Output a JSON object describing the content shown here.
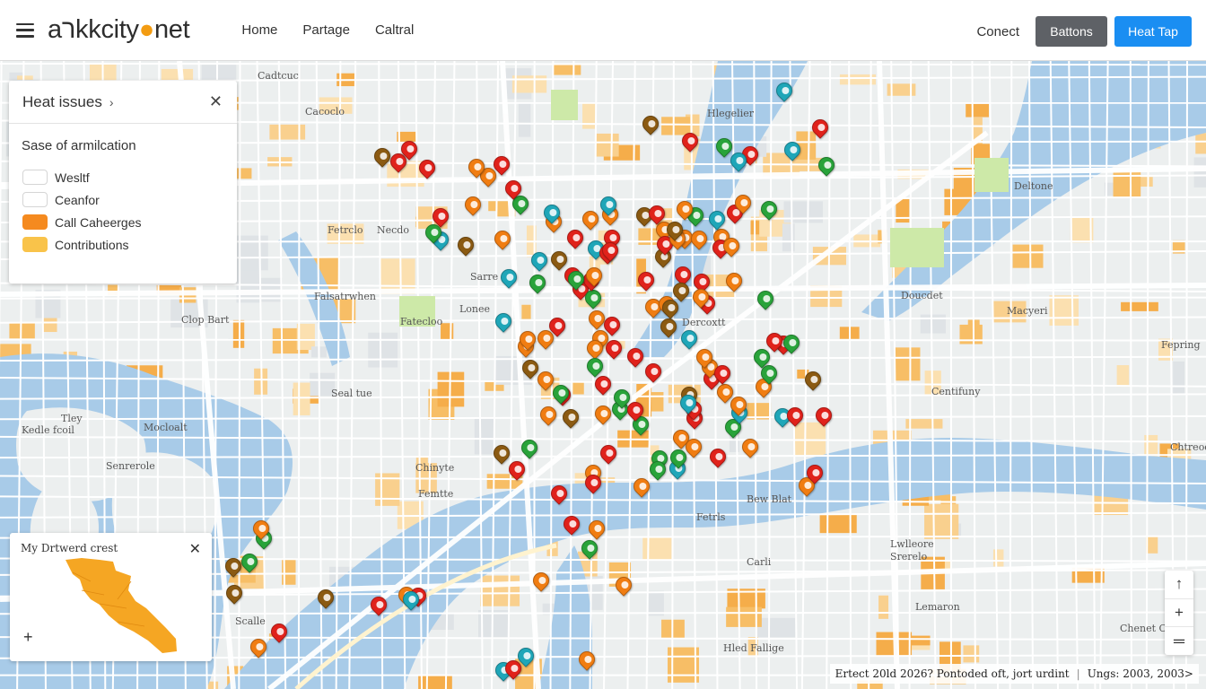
{
  "header": {
    "logo_text": "aרkkcity",
    "logo_suffix": "net",
    "nav": [
      "Home",
      "Partage",
      "Caltral"
    ],
    "connect_label": "Conect",
    "buttons_label": "Battons",
    "heat_tap_label": "Heat Tap"
  },
  "legend_panel": {
    "title": "Heat issues",
    "subtitle": "Sase of armilcation",
    "items": [
      {
        "label": "Wesltf",
        "color": "#ffffff"
      },
      {
        "label": "Ceanfor",
        "color": "#ffffff"
      },
      {
        "label": "Call Caheerges",
        "color": "#f58a1f"
      },
      {
        "label": "Contributions",
        "color": "#f9c34a"
      }
    ]
  },
  "mini_card": {
    "title": "My Drtwerd crest",
    "fill_color": "#f5a623"
  },
  "map_labels": [
    "Cadtcuc",
    "Cacoclo",
    "Fetrclo",
    "Necdo",
    "Falsatrwhen",
    "Clop Bart",
    "Sarre",
    "Lonee",
    "Fatecloo",
    "Seal tue",
    "Tley",
    "Kedle fcoil",
    "Mocloalt",
    "Senrerole",
    "Chinyte",
    "Femtte",
    "Deltone",
    "Macyeri",
    "Fepring",
    "Centifuny",
    "Chtreod Cyle",
    "Dercoxtt",
    "Bew Blat",
    "Fetrls",
    "Carli",
    "Lwlleore",
    "Lemaron",
    "Chenet Cdro",
    "Hled Fallige",
    "Scalle",
    "Srerelo",
    "Doucdet",
    "Hlegelier"
  ],
  "attribution": {
    "left": "Ertect 20ld 2026? Pontoded oft, jort urdint",
    "right": "Ungs: 2003, 2003>"
  },
  "zoom": {
    "up_label": "↑",
    "plus_label": "+",
    "menu_label": "═"
  },
  "colors": {
    "water": "#a8cbe8",
    "land": "#ecefef",
    "accent_blue": "#1a8ef2",
    "block_orange": "#f7be66",
    "block_green": "#cde9a8",
    "pin_red": "#e0221b",
    "pin_orange": "#f07d12",
    "pin_green": "#29a33a",
    "pin_teal": "#1fa6b8",
    "pin_brown": "#8b5a12"
  }
}
